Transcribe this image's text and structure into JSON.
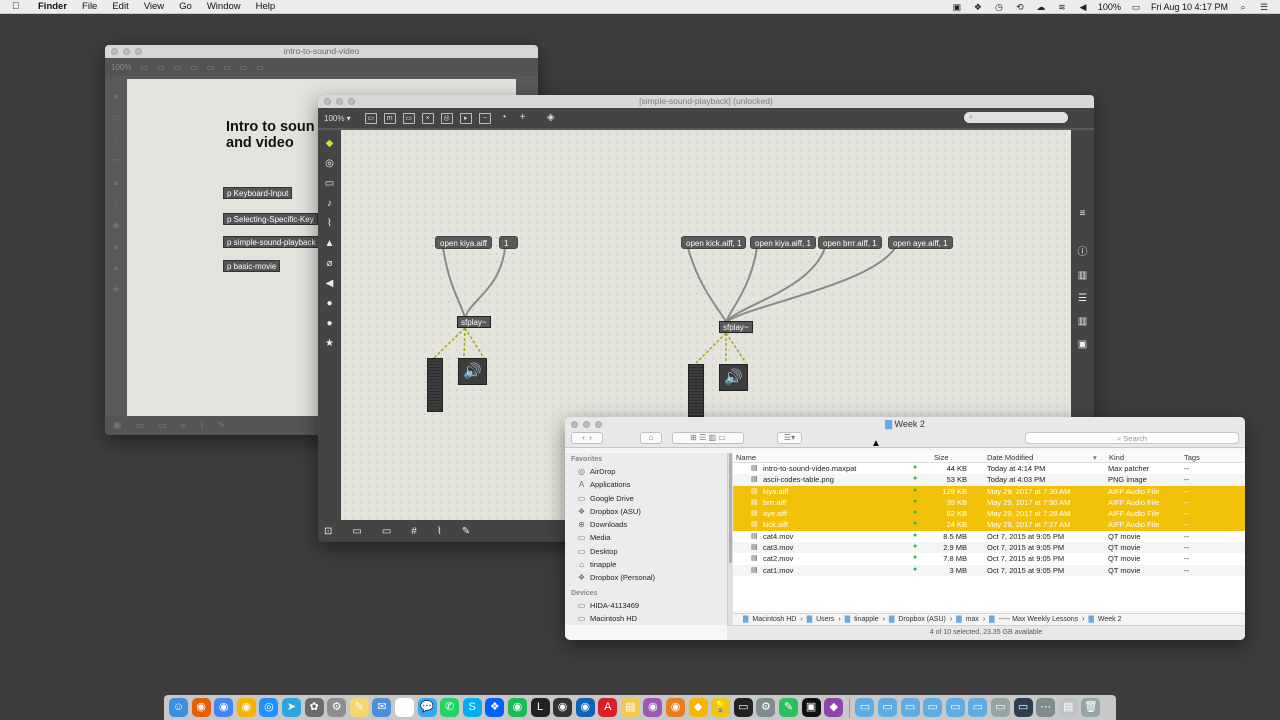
{
  "menubar": {
    "app": "Finder",
    "menus": [
      "File",
      "Edit",
      "View",
      "Go",
      "Window",
      "Help"
    ],
    "battery": "100%",
    "clock": "Fri Aug 10  4:17 PM"
  },
  "win_back": {
    "title": "intro-to-sound-video",
    "heading_line1": "Intro to soun",
    "heading_line2": "and video",
    "zoom": "100%",
    "subpatches": [
      "p Keyboard-Input",
      "p Selecting-Specific-Key",
      "p simple-sound-playback",
      "p basic-movie"
    ]
  },
  "win_patch": {
    "title": "[simple-sound-playback] (unlocked)",
    "zoom": "100% ▾",
    "left_messages": [
      "open kiya.aiff",
      "1"
    ],
    "right_messages": [
      "open kick.aiff, 1",
      "open kiya.aiff, 1",
      "open brrr.aiff, 1",
      "open aye.aiff, 1"
    ],
    "sfplay_label": "sfplay~"
  },
  "finder": {
    "title": "Week 2",
    "search_placeholder": "Search",
    "sidebar": {
      "favorites_heading": "Favorites",
      "favorites": [
        {
          "label": "AirDrop",
          "icon": "airdrop-icon",
          "glyph": "◎"
        },
        {
          "label": "Applications",
          "icon": "applications-icon",
          "glyph": "A"
        },
        {
          "label": "Google Drive",
          "icon": "folder-icon",
          "glyph": "▭"
        },
        {
          "label": "Dropbox (ASU)",
          "icon": "dropbox-icon",
          "glyph": "❖"
        },
        {
          "label": "Downloads",
          "icon": "downloads-icon",
          "glyph": "⊕"
        },
        {
          "label": "Media",
          "icon": "folder-icon",
          "glyph": "▭"
        },
        {
          "label": "Desktop",
          "icon": "desktop-icon",
          "glyph": "▭"
        },
        {
          "label": "tinapple",
          "icon": "home-icon",
          "glyph": "⌂"
        },
        {
          "label": "Dropbox (Personal)",
          "icon": "dropbox-icon",
          "glyph": "❖"
        }
      ],
      "devices_heading": "Devices",
      "devices": [
        {
          "label": "HIDA-4113469",
          "icon": "computer-icon",
          "glyph": "▭"
        },
        {
          "label": "Macintosh HD",
          "icon": "disk-icon",
          "glyph": "▭"
        }
      ]
    },
    "columns": {
      "name": "Name",
      "size": "Size",
      "date": "Date Modified",
      "kind": "Kind",
      "tags": "Tags"
    },
    "files": [
      {
        "name": "intro-to-sound-video.maxpat",
        "size": "44 KB",
        "date": "Today at 4:14 PM",
        "kind": "Max patcher",
        "tags": "--",
        "selected": false
      },
      {
        "name": "ascii-codes-table.png",
        "size": "53 KB",
        "date": "Today at 4:03 PM",
        "kind": "PNG image",
        "tags": "--",
        "selected": false
      },
      {
        "name": "kiya.aiff",
        "size": "129 KB",
        "date": "May 29, 2017 at 7:30 AM",
        "kind": "AIFF Audio File",
        "tags": "--",
        "selected": true
      },
      {
        "name": "brrr.aiff",
        "size": "39 KB",
        "date": "May 29, 2017 at 7:30 AM",
        "kind": "AIFF Audio File",
        "tags": "--",
        "selected": true
      },
      {
        "name": "aye.aiff",
        "size": "82 KB",
        "date": "May 29, 2017 at 7:28 AM",
        "kind": "AIFF Audio File",
        "tags": "--",
        "selected": true
      },
      {
        "name": "kick.aiff",
        "size": "24 KB",
        "date": "May 29, 2017 at 7:27 AM",
        "kind": "AIFF Audio File",
        "tags": "--",
        "selected": true
      },
      {
        "name": "cat4.mov",
        "size": "8.5 MB",
        "date": "Oct 7, 2015 at 9:05 PM",
        "kind": "QT movie",
        "tags": "--",
        "selected": false
      },
      {
        "name": "cat3.mov",
        "size": "2.9 MB",
        "date": "Oct 7, 2015 at 9:05 PM",
        "kind": "QT movie",
        "tags": "--",
        "selected": false
      },
      {
        "name": "cat2.mov",
        "size": "7.8 MB",
        "date": "Oct 7, 2015 at 9:05 PM",
        "kind": "QT movie",
        "tags": "--",
        "selected": false
      },
      {
        "name": "cat1.mov",
        "size": "3 MB",
        "date": "Oct 7, 2015 at 9:05 PM",
        "kind": "QT movie",
        "tags": "--",
        "selected": false
      }
    ],
    "path": [
      "Macintosh HD",
      "Users",
      "tinapple",
      "Dropbox (ASU)",
      "max",
      "----- Max Weekly Lessons",
      "Week 2"
    ],
    "status": "4 of 10 selected, 23.35 GB available"
  },
  "colors": {
    "selection": "#f2c20a",
    "patch_canvas": "#e4e4dd",
    "max_chrome": "#444444"
  },
  "dock": {
    "icons": [
      "finder-icon",
      "firefox-icon",
      "chrome-icon",
      "chrome-canary-icon",
      "safari-icon",
      "telegram-icon",
      "max-icon",
      "system-icon",
      "notes-icon",
      "mail-icon",
      "calendar-icon",
      "messages-icon",
      "whatsapp-icon",
      "skype-icon",
      "dropbox-icon",
      "spotify-icon",
      "live-icon",
      "logic-icon",
      "audacity-icon",
      "adobe-icon",
      "stickies-icon",
      "colorsync-icon",
      "photo-icon",
      "sketch-icon",
      "lamp-icon",
      "terminal-icon",
      "gear-icon",
      "evernote-icon",
      "terminal2-icon",
      "vectorworks-icon",
      "folder-icon",
      "folder2-icon",
      "folder3-icon",
      "stack-icon",
      "stack2-icon",
      "stack3-icon",
      "trash-icon",
      "screen-icon",
      "dots-icon",
      "doc-icon",
      "trash2-icon"
    ]
  }
}
